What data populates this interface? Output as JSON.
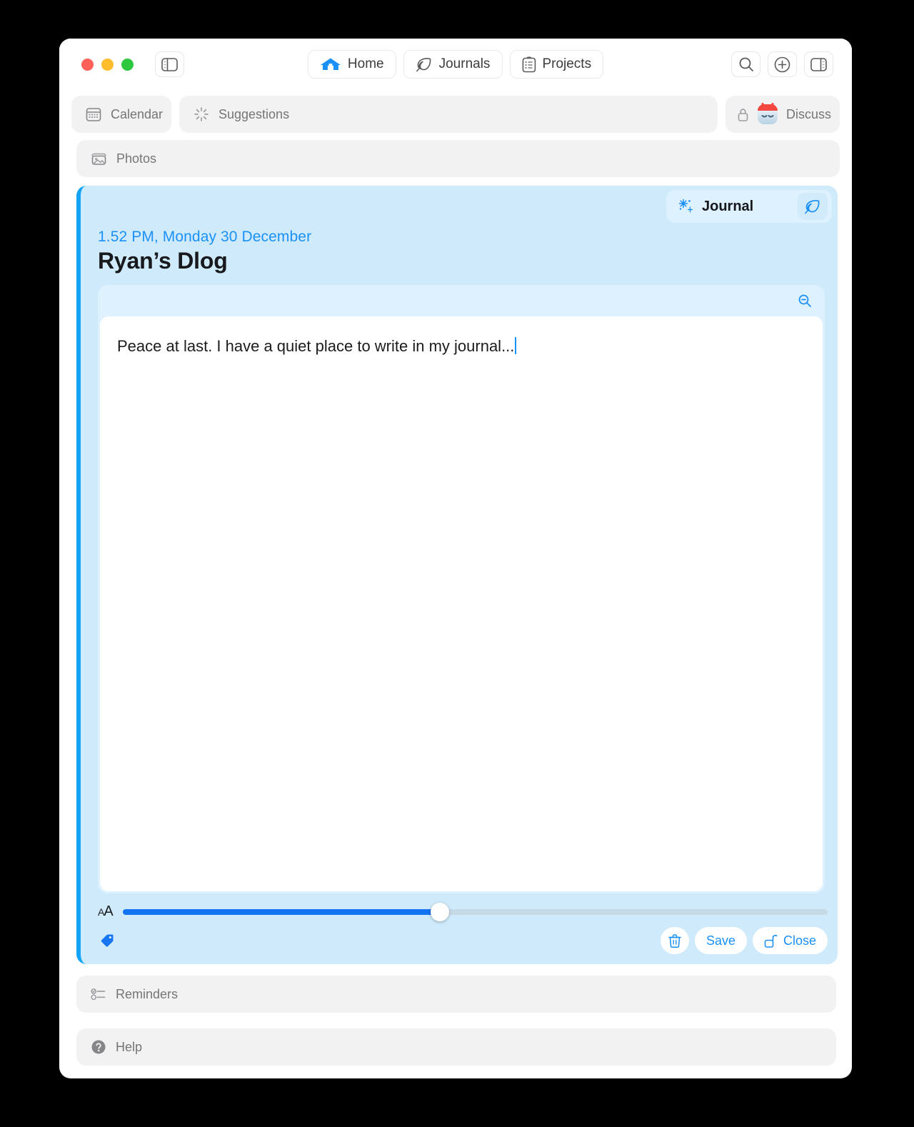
{
  "window": {
    "traffic_lights": [
      "close",
      "minimize",
      "zoom"
    ],
    "colors": {
      "accent_blue": "#1b90f7",
      "card_bg": "#cfebfb",
      "card_border": "#14a4f5",
      "editor_bg": "#ddf1fe",
      "chip_bg": "#f2f2f2",
      "slider_fill": "#1373f0"
    }
  },
  "toolbar": {
    "sidebar_toggle_label": "sidebar-toggle",
    "tabs": [
      {
        "label": "Home",
        "icon": "home-icon",
        "active": true
      },
      {
        "label": "Journals",
        "icon": "leaf-icon",
        "active": false
      },
      {
        "label": "Projects",
        "icon": "clipboard-icon",
        "active": false
      }
    ],
    "right_icons": [
      {
        "name": "search-icon"
      },
      {
        "name": "add-icon"
      },
      {
        "name": "inspector-toggle-icon"
      }
    ]
  },
  "chips": {
    "calendar": {
      "label": "Calendar",
      "icon": "calendar-icon"
    },
    "suggestions": {
      "label": "Suggestions",
      "icon": "sparkle-burst-icon"
    },
    "discuss": {
      "label": "Discuss",
      "icon": "lock-icon",
      "avatar": "bot-avatar"
    },
    "photos": {
      "label": "Photos",
      "icon": "photo-icon"
    }
  },
  "journal_card": {
    "pill_title": "Journal",
    "pill_icon": "sparkles-icon",
    "leaf_button": "leaf-icon",
    "entry_date": "1.52 PM, Monday 30 December",
    "entry_title": "Ryan’s Dlog",
    "zoom_out_button": "zoom-out-icon",
    "body_text": "Peace at last. I have a quiet place to write in my journal...",
    "font_size_slider": {
      "label_small": "A",
      "label_large": "A",
      "value_percent": 45
    },
    "tag_button": "tag-icon",
    "actions": [
      {
        "label": "",
        "icon": "trash-icon",
        "name": "delete-button"
      },
      {
        "label": "Save",
        "icon": "",
        "name": "save-button"
      },
      {
        "label": "Close",
        "icon": "unlock-icon",
        "name": "close-button"
      }
    ]
  },
  "bottom_sections": [
    {
      "label": "Reminders",
      "icon": "checklist-icon"
    },
    {
      "label": "Help",
      "icon": "question-circle-icon"
    }
  ]
}
